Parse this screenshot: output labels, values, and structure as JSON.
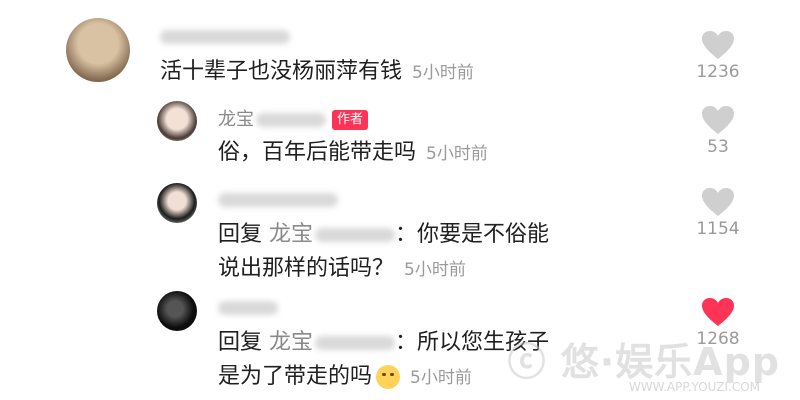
{
  "comments": [
    {
      "text": "活十辈子也没杨丽萍有钱",
      "time": "5小时前",
      "likes": "1236",
      "liked": false
    },
    {
      "name": "龙宝",
      "author_badge": "作者",
      "text": "俗，百年后能带走吗",
      "time": "5小时前",
      "likes": "53",
      "liked": false
    },
    {
      "reply_prefix": "回复",
      "reply_to": "龙宝",
      "text_line1": "：你要是不俗能",
      "text_line2": "说出那样的话吗？",
      "time": "5小时前",
      "likes": "1154",
      "liked": false
    },
    {
      "reply_prefix": "回复",
      "reply_to": "龙宝",
      "text_line1": "：所以您生孩子",
      "text_line2": "是为了带走的吗",
      "emoji": "relieved-face",
      "time": "5小时前",
      "likes": "1268",
      "liked": true
    }
  ],
  "colors": {
    "liked": "#ff3355",
    "unliked": "#cfcfcf",
    "badge": "#ff3355"
  },
  "watermark": {
    "main": "ⓒ 悠·娱乐App",
    "sub": "WWW.APP.YOUZI.COM"
  }
}
